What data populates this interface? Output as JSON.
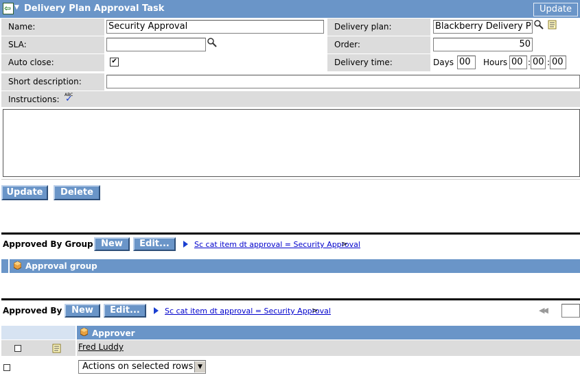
{
  "header": {
    "title": "Delivery Plan Approval Task",
    "update_label": "Update"
  },
  "form": {
    "name_label": "Name:",
    "name_value": "Security Approval",
    "sla_label": "SLA:",
    "sla_value": "",
    "auto_close_label": "Auto close:",
    "auto_close_checked": "✔",
    "short_desc_label": "Short description:",
    "short_desc_value": "",
    "instructions_label": "Instructions:",
    "spell_icon_text": "ABC",
    "delivery_plan_label": "Delivery plan:",
    "delivery_plan_value": "Blackberry Delivery Pla",
    "order_label": "Order:",
    "order_value": "50",
    "delivery_time_label": "Delivery time:",
    "days_label": "Days",
    "days_value": "00",
    "hours_label": "Hours",
    "hours_value": "00",
    "minutes_value": "00",
    "seconds_value": "00",
    "colon": ":"
  },
  "actions": {
    "update_label": "Update",
    "delete_label": "Delete"
  },
  "approved_by_group": {
    "title": "Approved By Group",
    "new_label": "New",
    "edit_label": "Edit...",
    "breadcrumb": "Sc cat item dt approval = Security Approval",
    "breadcrumb_suffix": ">",
    "column": "Approval group"
  },
  "approved_by": {
    "title": "Approved By",
    "new_label": "New",
    "edit_label": "Edit...",
    "breadcrumb": "Sc cat item dt approval = Security Approval",
    "breadcrumb_suffix": ">",
    "column": "Approver",
    "rows": [
      {
        "approver": "Fred Luddy"
      }
    ],
    "actions_select": "Actions on selected rows...",
    "pager_icon": "◀◀"
  },
  "colors": {
    "header_blue": "#6a95c8",
    "label_gray": "#dcdcdc",
    "link_blue": "#0000cc"
  }
}
